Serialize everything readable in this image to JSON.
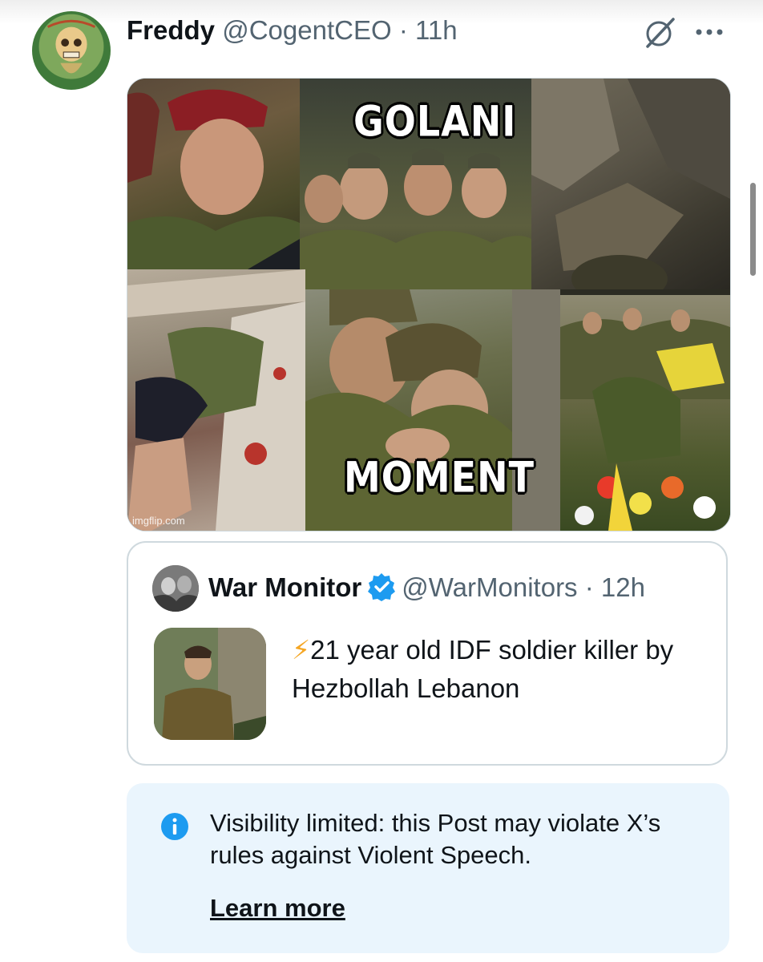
{
  "post": {
    "author_name": "Freddy",
    "author_handle": "@CogentCEO",
    "separator": "·",
    "time": "11h",
    "media": {
      "caption_top": "GOLANI",
      "caption_bottom": "MOMENT",
      "watermark": "imgflip.com"
    }
  },
  "quoted_post": {
    "author_name": "War Monitor",
    "author_handle": "@WarMonitors",
    "separator": "·",
    "time": "12h",
    "emoji": "⚡",
    "text": "21 year old IDF soldier killer by Hezbollah Lebanon"
  },
  "notice": {
    "text": "Visibility limited: this Post may violate X’s rules against Violent Speech.",
    "link_label": "Learn more"
  },
  "icons": {
    "grok": "grok-icon",
    "more": "more-icon",
    "verified": "verified-badge-icon",
    "info": "info-icon"
  },
  "colors": {
    "verified_blue": "#1d9bf0",
    "notice_background": "#eaf5fd",
    "secondary_text": "#536471"
  }
}
